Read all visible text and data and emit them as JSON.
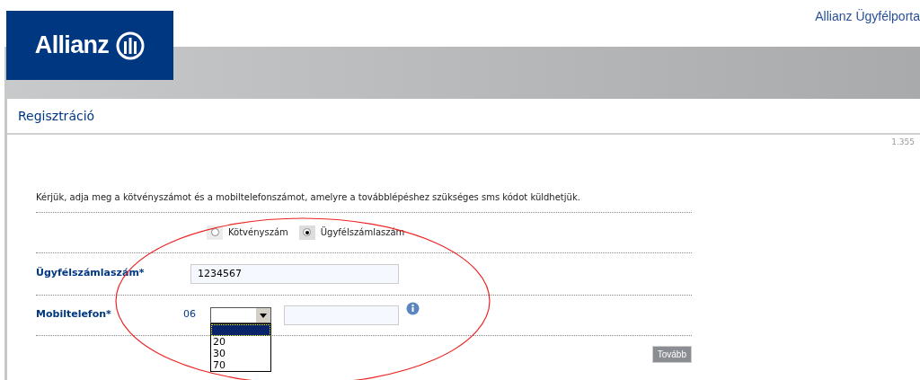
{
  "header": {
    "logo": "Allianz",
    "portal_title": "Allianz Ügyfélporta"
  },
  "panel": {
    "title": "Regisztráció",
    "version": "1.355"
  },
  "instructions": "Kérjük, adja meg a kötvényszámot és a mobiltelefonszámot, amelyre a továbblépéshez szükséges sms kódot küldhetjük.",
  "id_type": [
    {
      "label": "Kötvényszám",
      "selected": false
    },
    {
      "label": "Ügyfélszámlaszám",
      "selected": true
    }
  ],
  "account_field": {
    "label": "Ügyfélszámlaszám*",
    "value": "1234567"
  },
  "mobile_field": {
    "label": "Mobiltelefon*",
    "prefix": "06",
    "dropdown": {
      "expanded": true,
      "blank_highlighted": true,
      "options": [
        {
          "label": "20"
        },
        {
          "label": "30"
        },
        {
          "label": "70"
        }
      ]
    }
  },
  "next_button": "Tovább",
  "annotation": {
    "kind": "ellipse",
    "color": "#ee2222"
  }
}
